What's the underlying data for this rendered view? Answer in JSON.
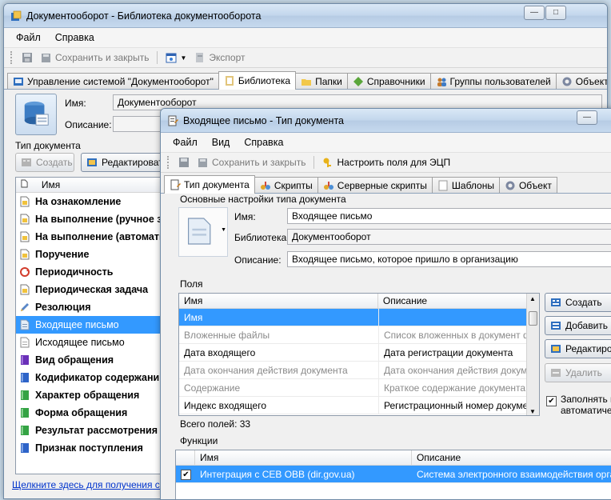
{
  "colors": {
    "selection": "#3399ff",
    "titlebar": "#c6d9ee",
    "window_bg": "#f0f0f0"
  },
  "main": {
    "title": "Документооборот - Библиотека документооборота",
    "menu": [
      "Файл",
      "Справка"
    ],
    "toolbar": {
      "save_close": "Сохранить и закрыть",
      "export": "Экспорт"
    },
    "tabs": [
      "Управление системой \"Документооборот\"",
      "Библиотека",
      "Папки",
      "Справочники",
      "Группы пользователей",
      "Объект"
    ],
    "name_label": "Имя:",
    "name_value": "Документооборот",
    "description_label": "Описание:",
    "doc_type_label": "Тип документа",
    "create_button": "Создать",
    "edit_button": "Редактироват",
    "list_header": "Имя",
    "items": [
      {
        "label": "На ознакомление",
        "icon": "document-yellow-icon"
      },
      {
        "label": "На выполнение (ручное з",
        "icon": "document-yellow-icon"
      },
      {
        "label": "На выполнение (автомати",
        "icon": "document-yellow-icon"
      },
      {
        "label": "Поручение",
        "icon": "document-yellow-icon"
      },
      {
        "label": "Периодичность",
        "icon": "cycle-red-icon"
      },
      {
        "label": "Периодическая задача",
        "icon": "document-yellow-icon"
      },
      {
        "label": "Резолюция",
        "icon": "pen-icon"
      },
      {
        "label": "Входящее письмо",
        "icon": "document-blue-icon"
      },
      {
        "label": "Исходящее письмо",
        "icon": "document-white-icon"
      },
      {
        "label": "Вид обращения",
        "icon": "book-purple-icon"
      },
      {
        "label": "Кодификатор содержани",
        "icon": "book-blue-icon"
      },
      {
        "label": "Характер обращения",
        "icon": "book-green-icon"
      },
      {
        "label": "Форма обращения",
        "icon": "book-green-icon"
      },
      {
        "label": "Результат рассмотрения",
        "icon": "book-green-icon"
      },
      {
        "label": "Признак поступления",
        "icon": "book-blue-icon"
      }
    ],
    "footer_link": "Щелкните здесь для получения сп"
  },
  "dialog": {
    "title": "Входящее письмо - Тип документа",
    "menu": [
      "Файл",
      "Вид",
      "Справка"
    ],
    "toolbar": {
      "save_close": "Сохранить и закрыть",
      "configure_fields": "Настроить поля для ЭЦП"
    },
    "tabs": [
      "Тип документа",
      "Скрипты",
      "Серверные скрипты",
      "Шаблоны",
      "Объект"
    ],
    "basic_settings_title": "Основные настройки типа документа",
    "name_label": "Имя:",
    "name_value": "Входящее письмо",
    "library_label": "Библиотека:",
    "library_value": "Документооборот",
    "description_label": "Описание:",
    "description_value": "Входящее письмо, которое пришло в организацию",
    "fields_title": "Поля",
    "fields_columns": [
      "Имя",
      "Описание"
    ],
    "fields_rows": [
      {
        "name": "Имя",
        "description": "",
        "style": "sel"
      },
      {
        "name": "Вложенные файлы",
        "description": "Список вложенных в документ фай",
        "style": "gray"
      },
      {
        "name": "Дата входящего",
        "description": "Дата регистрации документа",
        "style": ""
      },
      {
        "name": "Дата окончания действия документа",
        "description": "Дата окончания действия документ",
        "style": "gray"
      },
      {
        "name": "Содержание",
        "description": "Краткое содержание документа",
        "style": "gray"
      },
      {
        "name": "Индекс входящего",
        "description": "Регистрационный номер документа",
        "style": ""
      }
    ],
    "fields_total": "Всего полей: 33",
    "buttons": {
      "create": "Создать",
      "add": "Добавить",
      "edit": "Редактиров",
      "delete": "Удалить"
    },
    "autofill_label_1": "Заполнять и",
    "autofill_label_2": "автоматичес",
    "functions_title": "Функции",
    "functions_columns": [
      "Имя",
      "Описание"
    ],
    "functions_rows": [
      {
        "name": "Интеграция с СЕВ ОВВ (dir.gov.ua)",
        "description": "Система электронного взаимодействия органо",
        "checked": true
      }
    ]
  }
}
